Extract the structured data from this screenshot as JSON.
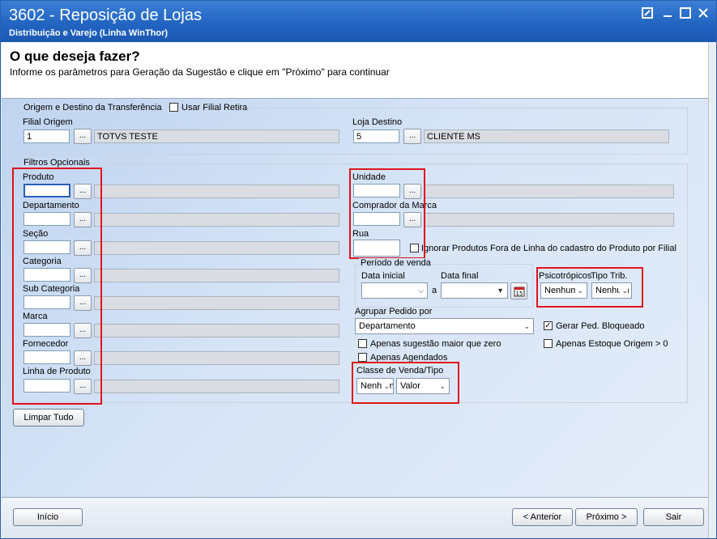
{
  "window": {
    "title": "3602 - Reposição de Lojas",
    "subtitle": "Distribuição e Varejo (Linha WinThor)",
    "controls": [
      "restore-icon",
      "minimize-icon",
      "maximize-icon",
      "close-icon"
    ]
  },
  "header": {
    "title": "O que deseja fazer?",
    "description": "Informe os parâmetros para Geração da Sugestão e clique em \"Próximo\" para continuar"
  },
  "origem_destino": {
    "group_label": "Origem e Destino da Transferência",
    "usar_filial_retira": "Usar Filial Retira",
    "filial_origem_label": "Filial Origem",
    "filial_origem_value": "1",
    "filial_origem_name": "TOTVS TESTE",
    "loja_destino_label": "Loja Destino",
    "loja_destino_value": "5",
    "loja_destino_name": "CLIENTE MS"
  },
  "filtros": {
    "group_label": "Filtros Opcionais",
    "left": [
      {
        "label": "Produto"
      },
      {
        "label": "Departamento"
      },
      {
        "label": "Seção"
      },
      {
        "label": "Categoria"
      },
      {
        "label": "Sub Categoria"
      },
      {
        "label": "Marca"
      },
      {
        "label": "Fornecedor"
      },
      {
        "label": "Linha de Produto"
      }
    ],
    "unidade_label": "Unidade",
    "comprador_label": "Comprador da Marca",
    "rua_label": "Rua",
    "ignorar_label": "Ignorar Produtos Fora de Linha do cadastro do Produto por Filial",
    "periodo_label": "Período de venda",
    "data_inicial_label": "Data inicial",
    "data_a": "a",
    "data_final_label": "Data final",
    "calendar_icon_text": "15",
    "psicotropicos_label": "Psicotrópicos",
    "psicotropicos_value": "Nenhum",
    "tipo_trib_label": "Tipo Trib.",
    "tipo_trib_value": "Nenhum",
    "agrupar_label": "Agrupar Pedido por",
    "agrupar_value": "Departamento",
    "gerar_bloqueado_label": "Gerar Ped. Bloqueado",
    "gerar_bloqueado_checked": true,
    "apenas_sugestao_label": "Apenas sugestão maior que zero",
    "apenas_estoque_label": "Apenas Estoque Origem > 0",
    "apenas_agendados_label": "Apenas Agendados",
    "classe_label": "Classe de Venda/Tipo",
    "classe_value": "Nenhum",
    "tipo_value": "Valor"
  },
  "limpar_tudo": "Limpar Tudo",
  "footer": {
    "inicio": "Início",
    "anterior": "< Anterior",
    "proximo": "Próximo >",
    "sair": "Sair"
  },
  "colors": {
    "titlebar": "#2163c0",
    "highlight_box": "#e0141e"
  }
}
